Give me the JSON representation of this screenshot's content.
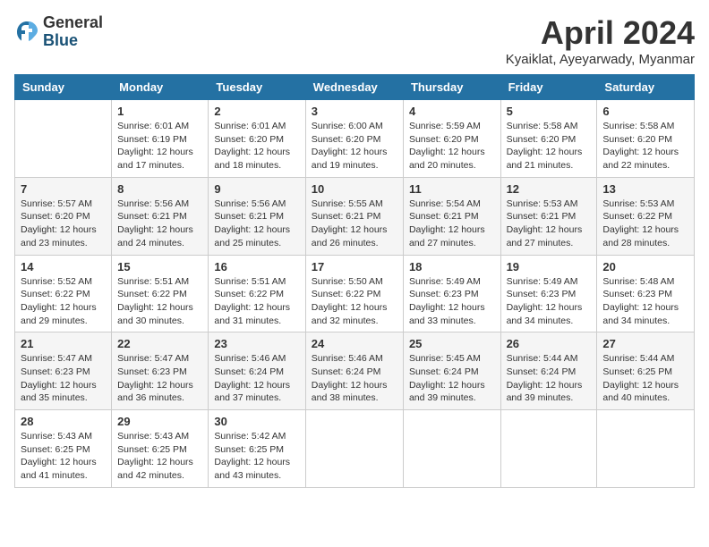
{
  "logo": {
    "general": "General",
    "blue": "Blue"
  },
  "title": "April 2024",
  "location": "Kyaiklat, Ayeyarwady, Myanmar",
  "headers": [
    "Sunday",
    "Monday",
    "Tuesday",
    "Wednesday",
    "Thursday",
    "Friday",
    "Saturday"
  ],
  "weeks": [
    [
      {
        "day": "",
        "sunrise": "",
        "sunset": "",
        "daylight": ""
      },
      {
        "day": "1",
        "sunrise": "Sunrise: 6:01 AM",
        "sunset": "Sunset: 6:19 PM",
        "daylight": "Daylight: 12 hours and 17 minutes."
      },
      {
        "day": "2",
        "sunrise": "Sunrise: 6:01 AM",
        "sunset": "Sunset: 6:20 PM",
        "daylight": "Daylight: 12 hours and 18 minutes."
      },
      {
        "day": "3",
        "sunrise": "Sunrise: 6:00 AM",
        "sunset": "Sunset: 6:20 PM",
        "daylight": "Daylight: 12 hours and 19 minutes."
      },
      {
        "day": "4",
        "sunrise": "Sunrise: 5:59 AM",
        "sunset": "Sunset: 6:20 PM",
        "daylight": "Daylight: 12 hours and 20 minutes."
      },
      {
        "day": "5",
        "sunrise": "Sunrise: 5:58 AM",
        "sunset": "Sunset: 6:20 PM",
        "daylight": "Daylight: 12 hours and 21 minutes."
      },
      {
        "day": "6",
        "sunrise": "Sunrise: 5:58 AM",
        "sunset": "Sunset: 6:20 PM",
        "daylight": "Daylight: 12 hours and 22 minutes."
      }
    ],
    [
      {
        "day": "7",
        "sunrise": "Sunrise: 5:57 AM",
        "sunset": "Sunset: 6:20 PM",
        "daylight": "Daylight: 12 hours and 23 minutes."
      },
      {
        "day": "8",
        "sunrise": "Sunrise: 5:56 AM",
        "sunset": "Sunset: 6:21 PM",
        "daylight": "Daylight: 12 hours and 24 minutes."
      },
      {
        "day": "9",
        "sunrise": "Sunrise: 5:56 AM",
        "sunset": "Sunset: 6:21 PM",
        "daylight": "Daylight: 12 hours and 25 minutes."
      },
      {
        "day": "10",
        "sunrise": "Sunrise: 5:55 AM",
        "sunset": "Sunset: 6:21 PM",
        "daylight": "Daylight: 12 hours and 26 minutes."
      },
      {
        "day": "11",
        "sunrise": "Sunrise: 5:54 AM",
        "sunset": "Sunset: 6:21 PM",
        "daylight": "Daylight: 12 hours and 27 minutes."
      },
      {
        "day": "12",
        "sunrise": "Sunrise: 5:53 AM",
        "sunset": "Sunset: 6:21 PM",
        "daylight": "Daylight: 12 hours and 27 minutes."
      },
      {
        "day": "13",
        "sunrise": "Sunrise: 5:53 AM",
        "sunset": "Sunset: 6:22 PM",
        "daylight": "Daylight: 12 hours and 28 minutes."
      }
    ],
    [
      {
        "day": "14",
        "sunrise": "Sunrise: 5:52 AM",
        "sunset": "Sunset: 6:22 PM",
        "daylight": "Daylight: 12 hours and 29 minutes."
      },
      {
        "day": "15",
        "sunrise": "Sunrise: 5:51 AM",
        "sunset": "Sunset: 6:22 PM",
        "daylight": "Daylight: 12 hours and 30 minutes."
      },
      {
        "day": "16",
        "sunrise": "Sunrise: 5:51 AM",
        "sunset": "Sunset: 6:22 PM",
        "daylight": "Daylight: 12 hours and 31 minutes."
      },
      {
        "day": "17",
        "sunrise": "Sunrise: 5:50 AM",
        "sunset": "Sunset: 6:22 PM",
        "daylight": "Daylight: 12 hours and 32 minutes."
      },
      {
        "day": "18",
        "sunrise": "Sunrise: 5:49 AM",
        "sunset": "Sunset: 6:23 PM",
        "daylight": "Daylight: 12 hours and 33 minutes."
      },
      {
        "day": "19",
        "sunrise": "Sunrise: 5:49 AM",
        "sunset": "Sunset: 6:23 PM",
        "daylight": "Daylight: 12 hours and 34 minutes."
      },
      {
        "day": "20",
        "sunrise": "Sunrise: 5:48 AM",
        "sunset": "Sunset: 6:23 PM",
        "daylight": "Daylight: 12 hours and 34 minutes."
      }
    ],
    [
      {
        "day": "21",
        "sunrise": "Sunrise: 5:47 AM",
        "sunset": "Sunset: 6:23 PM",
        "daylight": "Daylight: 12 hours and 35 minutes."
      },
      {
        "day": "22",
        "sunrise": "Sunrise: 5:47 AM",
        "sunset": "Sunset: 6:23 PM",
        "daylight": "Daylight: 12 hours and 36 minutes."
      },
      {
        "day": "23",
        "sunrise": "Sunrise: 5:46 AM",
        "sunset": "Sunset: 6:24 PM",
        "daylight": "Daylight: 12 hours and 37 minutes."
      },
      {
        "day": "24",
        "sunrise": "Sunrise: 5:46 AM",
        "sunset": "Sunset: 6:24 PM",
        "daylight": "Daylight: 12 hours and 38 minutes."
      },
      {
        "day": "25",
        "sunrise": "Sunrise: 5:45 AM",
        "sunset": "Sunset: 6:24 PM",
        "daylight": "Daylight: 12 hours and 39 minutes."
      },
      {
        "day": "26",
        "sunrise": "Sunrise: 5:44 AM",
        "sunset": "Sunset: 6:24 PM",
        "daylight": "Daylight: 12 hours and 39 minutes."
      },
      {
        "day": "27",
        "sunrise": "Sunrise: 5:44 AM",
        "sunset": "Sunset: 6:25 PM",
        "daylight": "Daylight: 12 hours and 40 minutes."
      }
    ],
    [
      {
        "day": "28",
        "sunrise": "Sunrise: 5:43 AM",
        "sunset": "Sunset: 6:25 PM",
        "daylight": "Daylight: 12 hours and 41 minutes."
      },
      {
        "day": "29",
        "sunrise": "Sunrise: 5:43 AM",
        "sunset": "Sunset: 6:25 PM",
        "daylight": "Daylight: 12 hours and 42 minutes."
      },
      {
        "day": "30",
        "sunrise": "Sunrise: 5:42 AM",
        "sunset": "Sunset: 6:25 PM",
        "daylight": "Daylight: 12 hours and 43 minutes."
      },
      {
        "day": "",
        "sunrise": "",
        "sunset": "",
        "daylight": ""
      },
      {
        "day": "",
        "sunrise": "",
        "sunset": "",
        "daylight": ""
      },
      {
        "day": "",
        "sunrise": "",
        "sunset": "",
        "daylight": ""
      },
      {
        "day": "",
        "sunrise": "",
        "sunset": "",
        "daylight": ""
      }
    ]
  ]
}
